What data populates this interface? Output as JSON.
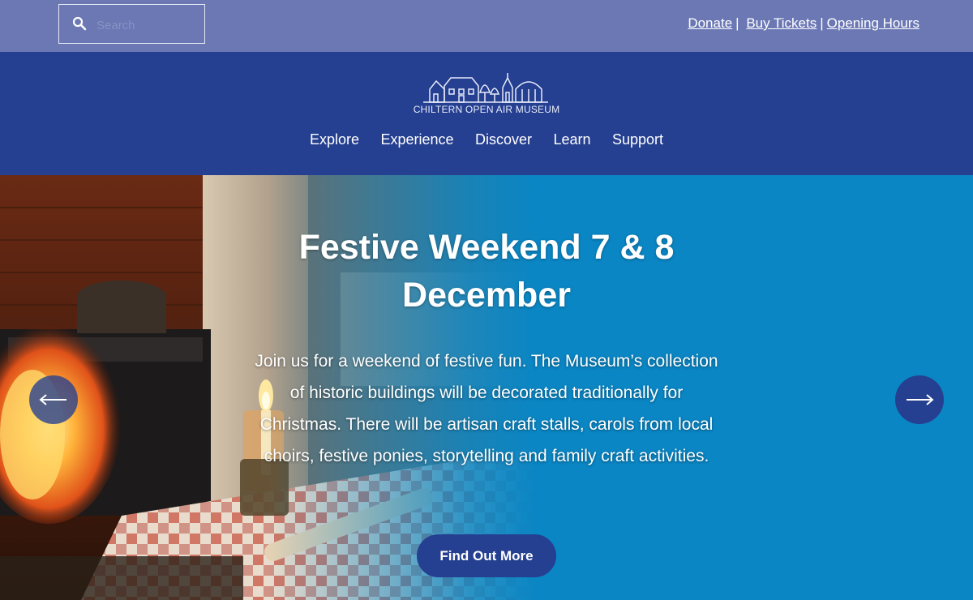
{
  "search": {
    "placeholder": "Search"
  },
  "util_links": {
    "donate": "Donate",
    "buy_tickets": "Buy Tickets",
    "opening_hours": "Opening Hours",
    "separator": "|"
  },
  "logo": {
    "text": "CHILTERN OPEN AIR MUSEUM"
  },
  "nav": {
    "explore": "Explore",
    "experience": "Experience",
    "discover": "Discover",
    "learn": "Learn",
    "support": "Support"
  },
  "hero": {
    "title": "Festive Weekend 7 & 8 December",
    "text": "Join us for a weekend of festive fun. The Museum’s collection of historic buildings will be decorated traditionally for Christmas. There will be artisan craft stalls, carols from local choirs, festive ponies, storytelling and family craft activities.",
    "cta": "Find Out More"
  },
  "icons": {
    "search": "search-icon",
    "prev": "arrow-left-icon",
    "next": "arrow-right-icon"
  },
  "colors": {
    "topbar": "#6b78b4",
    "header": "#253f91",
    "hero_blue": "#0a86c4",
    "button": "#253f91"
  }
}
